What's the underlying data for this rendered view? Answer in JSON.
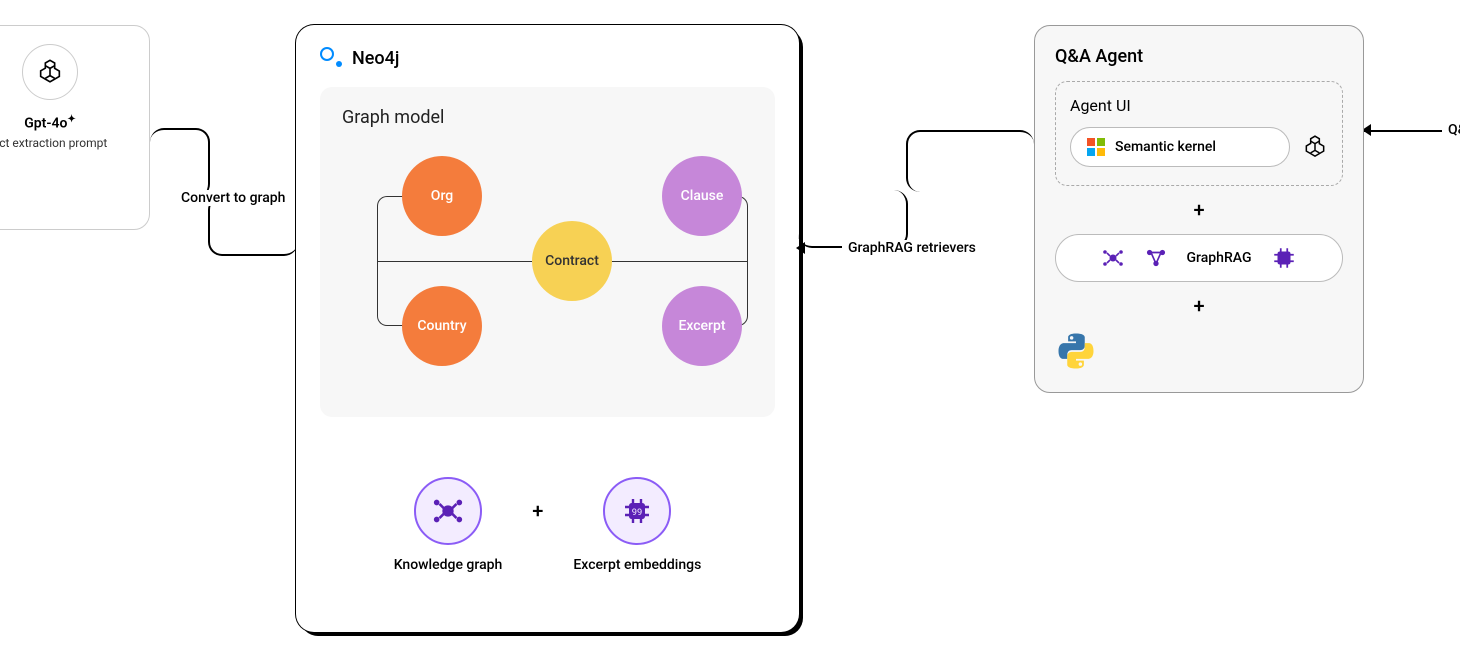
{
  "left": {
    "model": "Gpt‑4o",
    "sub": "act extraction prompt"
  },
  "conn1": "Convert to graph",
  "neo4j": {
    "title": "Neo4j",
    "graph_title": "Graph model",
    "nodes": {
      "org": "Org",
      "country": "Country",
      "contract": "Contract",
      "clause": "Clause",
      "excerpt": "Excerpt"
    },
    "kg": "Knowledge graph",
    "em": "Excerpt embeddings"
  },
  "conn2": "GraphRAG retrievers",
  "qa": {
    "title": "Q&A Agent",
    "agent_ui": "Agent UI",
    "sk": "Semantic kernel",
    "graphrag": "GraphRAG"
  },
  "conn3": "Q&A",
  "plus": "+"
}
